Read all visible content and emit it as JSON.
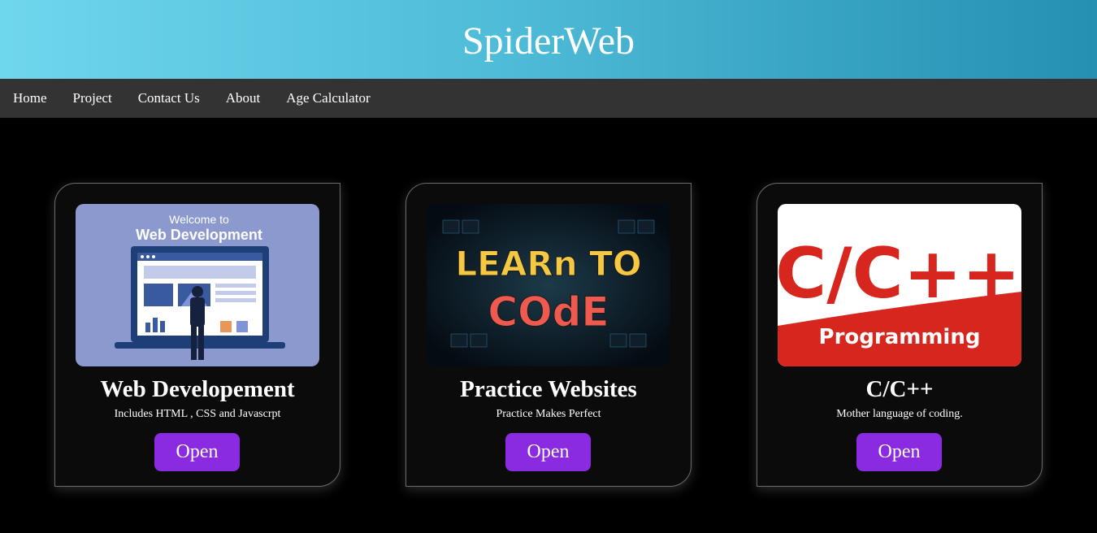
{
  "header": {
    "title": "SpiderWeb"
  },
  "nav": {
    "items": [
      "Home",
      "Project",
      "Contact Us",
      "About",
      "Age Calculator"
    ]
  },
  "cards": [
    {
      "image_text_1": "Welcome to",
      "image_text_2": "Web Development",
      "title": "Web Developement",
      "description": "Includes HTML , CSS and Javascrpt",
      "button": "Open"
    },
    {
      "image_text_1": "LEARn TO",
      "image_text_2": "COdE",
      "title": "Practice Websites",
      "description": "Practice Makes Perfect",
      "button": "Open"
    },
    {
      "image_text_1": "C/C++",
      "image_text_2": "Programming",
      "title": "C/C++",
      "description": "Mother language of coding.",
      "button": "Open"
    }
  ],
  "colors": {
    "header_gradient_start": "#6fd6ee",
    "header_gradient_end": "#2590b2",
    "nav_background": "#333333",
    "page_background": "#000000",
    "button_purple": "#8a2be2"
  }
}
